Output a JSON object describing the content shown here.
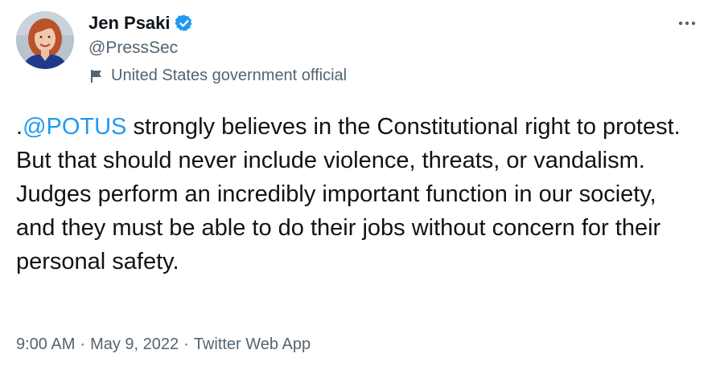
{
  "author": {
    "display_name": "Jen Psaki",
    "handle": "@PressSec",
    "label": "United States government official",
    "avatar_icon": "avatar-photo",
    "verified_icon": "verified-badge-icon",
    "label_icon": "flag-icon"
  },
  "menu": {
    "more_icon": "more-options-icon"
  },
  "tweet": {
    "text_prefix": ".",
    "mention": "@POTUS",
    "text_body": " strongly believes in the Constitutional right to protest. But that should never include violence, threats, or vandalism. Judges perform an incredibly important function in our society, and they must be able to do their jobs without concern for their personal safety."
  },
  "meta": {
    "time": "9:00 AM",
    "separator": "·",
    "date": "May 9, 2022",
    "source": "Twitter Web App"
  },
  "colors": {
    "link": "#1d9bf0",
    "secondary_text": "#536471",
    "primary_text": "#0f1419",
    "verified": "#1d9bf0"
  }
}
